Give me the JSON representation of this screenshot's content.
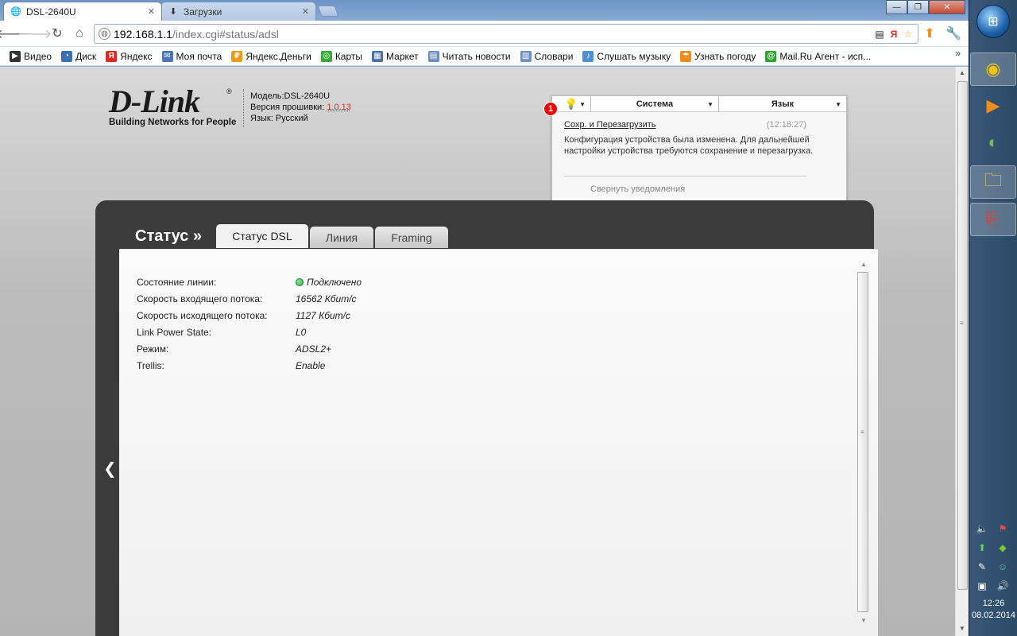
{
  "browser": {
    "tabs": [
      {
        "title": "DSL-2640U",
        "icon": "globe-icon"
      },
      {
        "title": "Загрузки",
        "icon": "download-icon"
      }
    ],
    "address": {
      "host": "192.168.1.1",
      "path": "/index.cgi#status/adsl"
    },
    "window_controls": {
      "minimize": "—",
      "maximize": "❐",
      "close": "✕"
    },
    "bookmarks": [
      {
        "label": "Видео",
        "icon": "video-icon",
        "color": "#333333"
      },
      {
        "label": "Диск",
        "icon": "disk-icon",
        "color": "#3b6fb6"
      },
      {
        "label": "Яндекс",
        "icon": "yandex-icon",
        "color": "#e52620"
      },
      {
        "label": "Моя почта",
        "icon": "mail-icon",
        "color": "#4a76b8"
      },
      {
        "label": "Яндекс.Деньги",
        "icon": "money-icon",
        "color": "#f09a1a"
      },
      {
        "label": "Карты",
        "icon": "maps-icon",
        "color": "#3aa83a"
      },
      {
        "label": "Маркет",
        "icon": "market-icon",
        "color": "#4b6ea3"
      },
      {
        "label": "Читать новости",
        "icon": "news-icon",
        "color": "#6c8fbf"
      },
      {
        "label": "Словари",
        "icon": "dictionary-icon",
        "color": "#6c8fbf"
      },
      {
        "label": "Слушать музыку",
        "icon": "music-icon",
        "color": "#4e8fd6"
      },
      {
        "label": "Узнать погоду",
        "icon": "weather-icon",
        "color": "#f08c1a"
      },
      {
        "label": "Mail.Ru Агент - исп...",
        "icon": "mailru-agent-icon",
        "color": "#2aa52a"
      }
    ],
    "bookmarks_more": "»"
  },
  "router": {
    "brand": "D-Link",
    "tagline": "Building Networks for People",
    "model_line": "Модель:DSL-2640U",
    "firmware_label": "Версия прошивки:",
    "firmware_value": "1.0.13",
    "language_line": "Язык: Русский"
  },
  "notifications": {
    "badge_count": "1",
    "menu_system": "Система",
    "menu_language": "Язык",
    "link": "Сохр. и Перезагрузить",
    "time": "(12:18:27)",
    "message": "Конфигурация устройства была изменена. Для дальнейшей настройки устройства требуются сохранение и перезагрузка.",
    "collapse": "Свернуть уведомления"
  },
  "page": {
    "title": "Статус »",
    "tabs": [
      "Статус DSL",
      "Линия",
      "Framing"
    ],
    "rows": [
      {
        "label": "Состояние линии:",
        "value": "Подключено"
      },
      {
        "label": "Скорость входящего потока:",
        "value": "16562 Кбит/с"
      },
      {
        "label": "Скорость исходящего потока:",
        "value": "1127 Кбит/с"
      },
      {
        "label": "Link Power State:",
        "value": "L0"
      },
      {
        "label": "Режим:",
        "value": "ADSL2+"
      },
      {
        "label": "Trellis:",
        "value": "Enable"
      }
    ],
    "status_color": "#2aa52a"
  },
  "taskbar": {
    "time": "12:26",
    "date": "08.02.2014"
  }
}
